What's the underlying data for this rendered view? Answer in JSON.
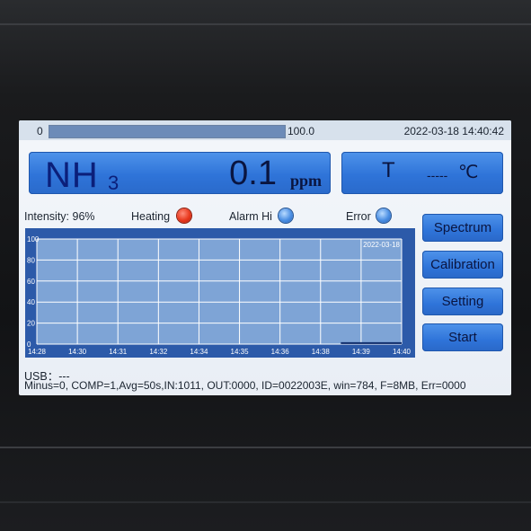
{
  "top_bar": {
    "range_min": "0",
    "range_max": "100.0",
    "datetime": "2022-03-18 14:40:42"
  },
  "reading": {
    "gas_name": "NH",
    "gas_subscript": "3",
    "value": "0.1",
    "unit": "ppm"
  },
  "temperature": {
    "label": "T",
    "value": "-----",
    "unit": "℃"
  },
  "status": {
    "intensity": "Intensity: 96%",
    "heating": "Heating",
    "alarm": "Alarm Hi",
    "error": "Error"
  },
  "buttons": {
    "spectrum": "Spectrum",
    "calibration": "Calibration",
    "setting": "Setting",
    "start": "Start"
  },
  "footer": {
    "usb": "USB：---",
    "info": "Minus=0, COMP=1,Avg=50s,IN:1011, OUT:0000, ID=0022003E, win=784, F=8MB, Err=0000"
  },
  "colors": {
    "screen_bg": "#eef3f8",
    "panel_blue": "#3a7fe0",
    "plot_bg": "#7ea4d6",
    "grid": "#ffffff",
    "led_heating": "#e8381d",
    "led_idle": "#4a8ee3"
  },
  "chart_data": {
    "type": "line",
    "date_label": "2022-03-18",
    "x_ticks": [
      "14:28",
      "14:30",
      "14:31",
      "14:32",
      "14:34",
      "14:35",
      "14:36",
      "14:38",
      "14:39",
      "14:40"
    ],
    "y_ticks": [
      "0",
      "20",
      "40",
      "60",
      "80",
      "100"
    ],
    "ylim": [
      0,
      100
    ],
    "grid": true,
    "series": [
      {
        "x": [
          "14:39",
          "14:40"
        ],
        "values": [
          0.1,
          0.1
        ]
      }
    ]
  }
}
